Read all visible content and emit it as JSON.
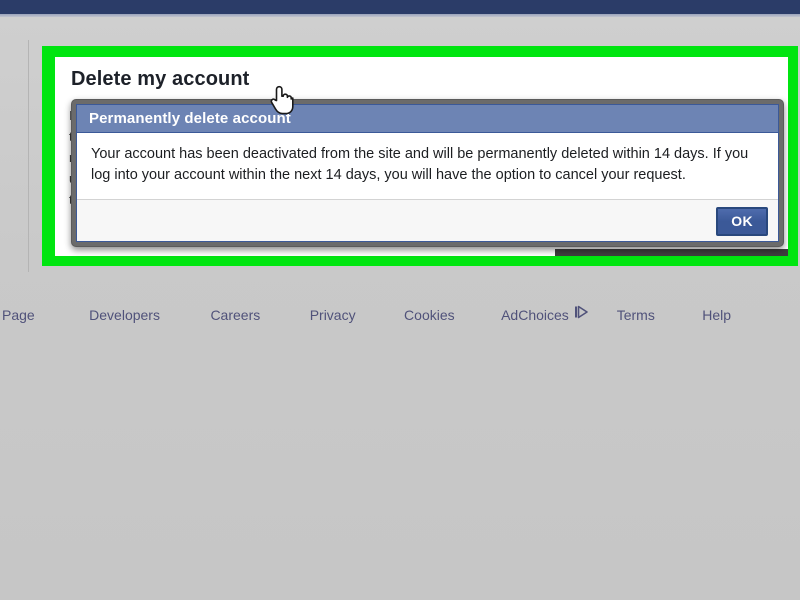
{
  "chrome": {
    "topbar_color": "#2b3c68"
  },
  "annotation": {
    "highlight_color": "#00e510"
  },
  "content": {
    "heading": "Delete my account",
    "occluded_background_lines": [
      "I",
      "t",
      "r",
      "u",
      "t"
    ]
  },
  "dialog": {
    "title": "Permanently delete account",
    "message": "Your account has been deactivated from the site and will be permanently deleted within 14 days. If you log into your account within the next 14 days, you will have the option to cancel your request.",
    "ok_label": "OK",
    "titlebar_color": "#6d84b4",
    "button_color": "#3b5998"
  },
  "footer": {
    "links": [
      {
        "label": "Page"
      },
      {
        "label": "Developers"
      },
      {
        "label": "Careers"
      },
      {
        "label": "Privacy"
      },
      {
        "label": "Cookies"
      },
      {
        "label": "AdChoices"
      },
      {
        "label": "Terms"
      },
      {
        "label": "Help"
      }
    ],
    "link_color": "#50527a"
  },
  "cursor": {
    "type": "pointing-hand"
  }
}
